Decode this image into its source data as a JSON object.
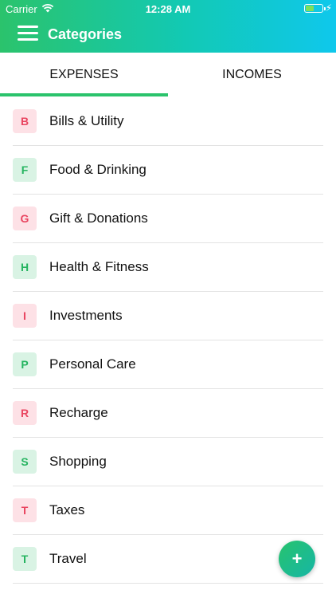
{
  "status_bar": {
    "carrier": "Carrier",
    "time": "12:28 AM"
  },
  "header": {
    "title": "Categories",
    "menu_icon": "hamburger-menu-icon"
  },
  "tabs": [
    {
      "label": "EXPENSES",
      "active": true
    },
    {
      "label": "INCOMES",
      "active": false
    }
  ],
  "categories": [
    {
      "letter": "B",
      "label": "Bills & Utility",
      "color": "red"
    },
    {
      "letter": "F",
      "label": "Food & Drinking",
      "color": "green"
    },
    {
      "letter": "G",
      "label": "Gift & Donations",
      "color": "red"
    },
    {
      "letter": "H",
      "label": "Health & Fitness",
      "color": "green"
    },
    {
      "letter": "I",
      "label": "Investments",
      "color": "red"
    },
    {
      "letter": "P",
      "label": "Personal Care",
      "color": "green"
    },
    {
      "letter": "R",
      "label": "Recharge",
      "color": "red"
    },
    {
      "letter": "S",
      "label": "Shopping",
      "color": "green"
    },
    {
      "letter": "T",
      "label": "Taxes",
      "color": "red"
    },
    {
      "letter": "T",
      "label": "Travel",
      "color": "green"
    }
  ],
  "fab": {
    "label": "+",
    "icon": "add-icon"
  },
  "colors": {
    "header_start": "#2bc36c",
    "header_end": "#0fc8ec",
    "accent_green": "#2bc36c",
    "badge_red_text": "#e94560",
    "badge_green_text": "#26b460"
  }
}
